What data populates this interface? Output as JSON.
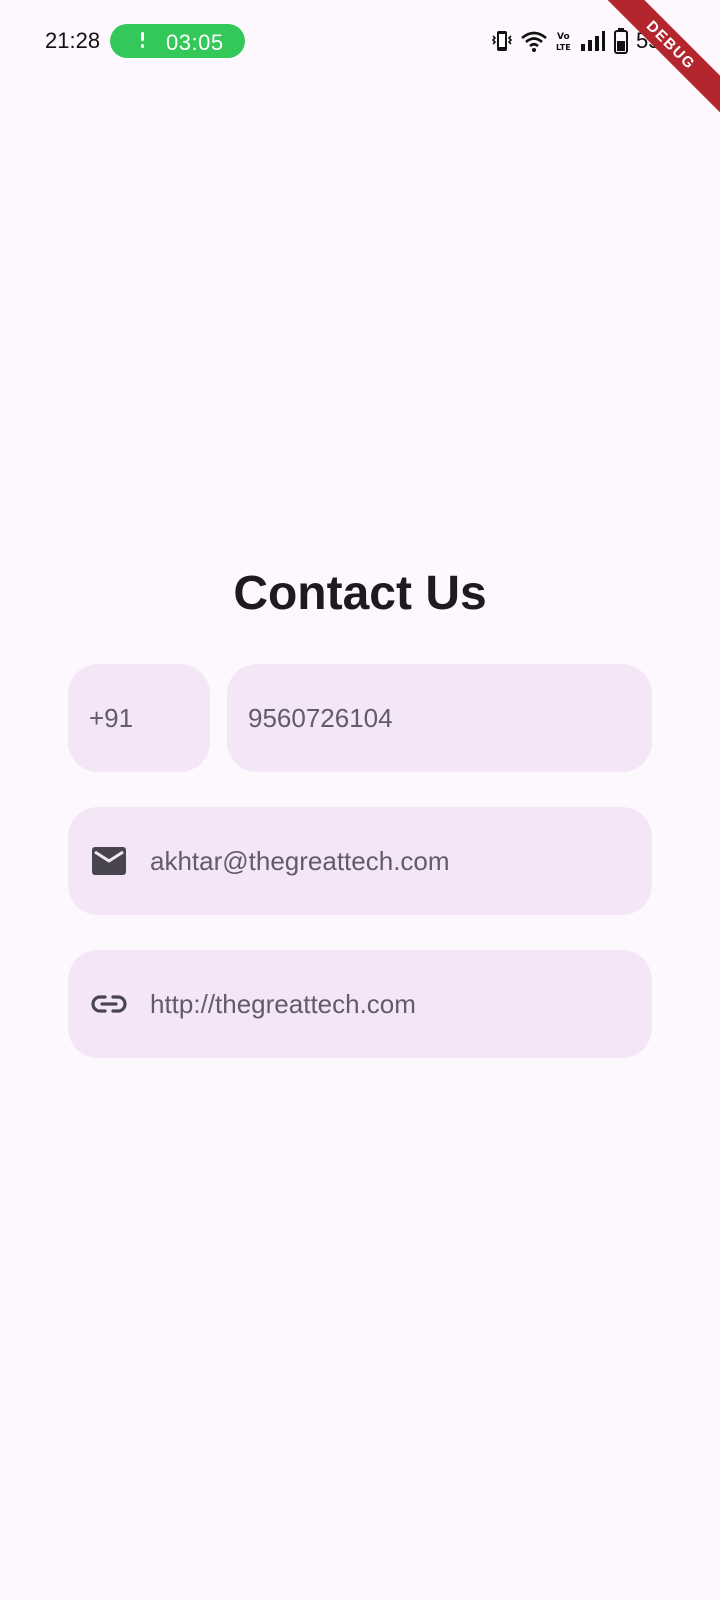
{
  "status_bar": {
    "time": "21:28",
    "call_timer": "03:05",
    "battery_percent": "55%",
    "call_pill_color": "#34c759"
  },
  "debug_banner": {
    "label": "DEBUG",
    "color": "#b3262e"
  },
  "contact": {
    "title": "Contact Us",
    "country_code": "+91",
    "phone": "9560726104",
    "email": "akhtar@thegreattech.com",
    "website": "http://thegreattech.com",
    "icons": {
      "email": "email-icon",
      "website": "link-icon"
    }
  },
  "colors": {
    "background": "#fdf8fd",
    "field_fill": "#f4e6f6",
    "field_text": "#625b6a",
    "title_text": "#1d1b20"
  }
}
